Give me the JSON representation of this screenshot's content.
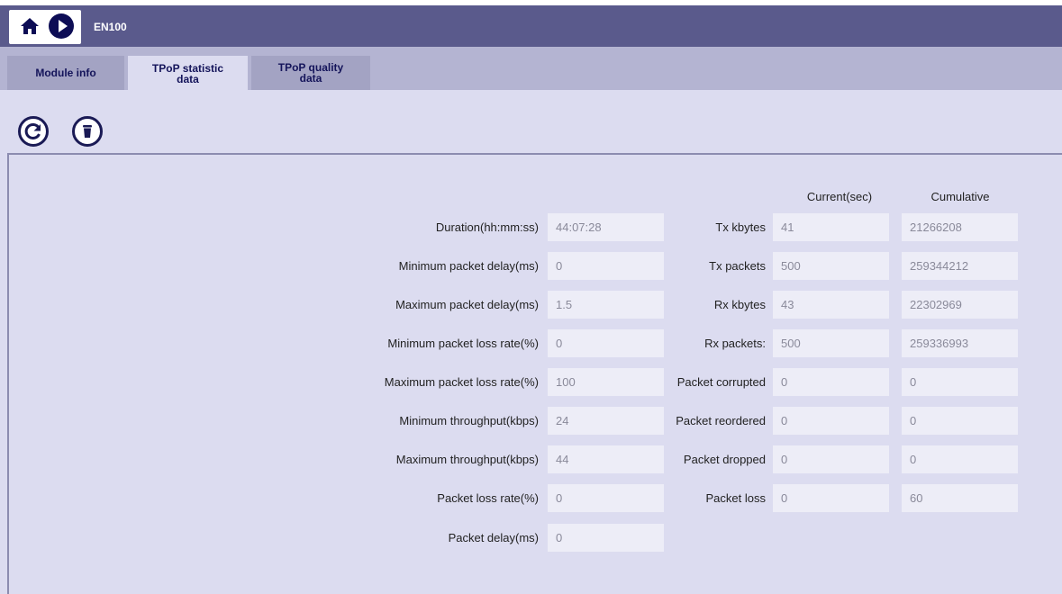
{
  "header": {
    "device_name": "EN100",
    "icons": [
      "home-icon",
      "play-icon"
    ]
  },
  "tabs": [
    {
      "label_line1": "Module info",
      "label_line2": ""
    },
    {
      "label_line1": "TPoP statistic",
      "label_line2": "data"
    },
    {
      "label_line1": "TPoP quality",
      "label_line2": "data"
    }
  ],
  "toolbar": {
    "icons": [
      "refresh-icon",
      "trash-icon"
    ]
  },
  "columns": {
    "current": "Current(sec)",
    "cumulative": "Cumulative"
  },
  "left_stats": [
    {
      "label": "Duration(hh:mm:ss)",
      "value": "44:07:28"
    },
    {
      "label": "Minimum packet delay(ms)",
      "value": "0"
    },
    {
      "label": "Maximum packet delay(ms)",
      "value": "1.5"
    },
    {
      "label": "Minimum packet loss rate(%)",
      "value": "0"
    },
    {
      "label": "Maximum packet loss rate(%)",
      "value": "100"
    },
    {
      "label": "Minimum throughput(kbps)",
      "value": "24"
    },
    {
      "label": "Maximum throughput(kbps)",
      "value": "44"
    },
    {
      "label": "Packet loss rate(%)",
      "value": "0"
    },
    {
      "label": "Packet delay(ms)",
      "value": "0"
    }
  ],
  "right_stats": [
    {
      "label": "Tx kbytes",
      "current": "41",
      "cumulative": "21266208"
    },
    {
      "label": "Tx packets",
      "current": "500",
      "cumulative": "259344212"
    },
    {
      "label": "Rx kbytes",
      "current": "43",
      "cumulative": "22302969"
    },
    {
      "label": "Rx packets:",
      "current": "500",
      "cumulative": "259336993"
    },
    {
      "label": "Packet corrupted",
      "current": "0",
      "cumulative": "0"
    },
    {
      "label": "Packet reordered",
      "current": "0",
      "cumulative": "0"
    },
    {
      "label": "Packet dropped",
      "current": "0",
      "cumulative": "0"
    },
    {
      "label": "Packet loss",
      "current": "0",
      "cumulative": "60"
    }
  ],
  "colors": {
    "header_bg": "#5a5a8c",
    "tabbar_bg": "#b4b4d2",
    "page_bg": "#dcdcf0",
    "field_bg": "#ededf7"
  }
}
